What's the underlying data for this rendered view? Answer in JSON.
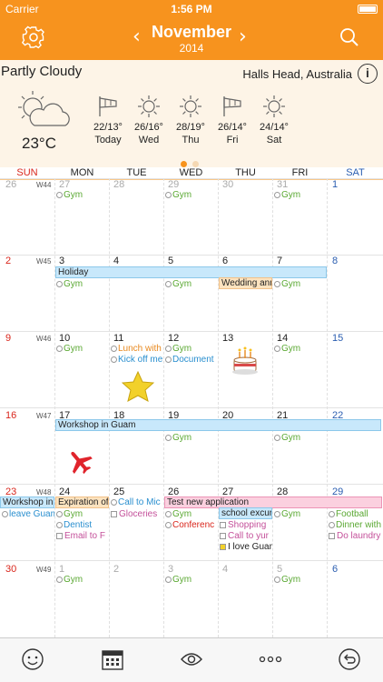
{
  "status": {
    "carrier": "Carrier",
    "time": "1:56 PM"
  },
  "nav": {
    "month": "November",
    "year": "2014"
  },
  "weather": {
    "condition": "Partly Cloudy",
    "location": "Halls Head, Australia",
    "info": "i",
    "temp": "23°C",
    "forecast": [
      {
        "temp": "22/13°",
        "day": "Today",
        "icon": "wind-icon"
      },
      {
        "temp": "26/16°",
        "day": "Wed",
        "icon": "sun-icon"
      },
      {
        "temp": "28/19°",
        "day": "Thu",
        "icon": "sun-icon"
      },
      {
        "temp": "26/14°",
        "day": "Fri",
        "icon": "wind-icon"
      },
      {
        "temp": "24/14°",
        "day": "Sat",
        "icon": "sun-icon"
      }
    ]
  },
  "weekdays": [
    "SUN",
    "MON",
    "TUE",
    "WED",
    "THU",
    "FRI",
    "SAT"
  ],
  "colors": {
    "accent": "#f7931e",
    "sunday": "#d9261c",
    "saturday": "#2a5db0",
    "green": "#5aa832",
    "holiday": "#c8e8fb",
    "wedding": "#fce3bf",
    "pink": "#fbd0df"
  },
  "weeks": [
    {
      "label": "W44",
      "days": [
        "26",
        "27",
        "28",
        "29",
        "30",
        "31",
        "1"
      ]
    },
    {
      "label": "W45",
      "days": [
        "2",
        "3",
        "4",
        "5",
        "6",
        "7",
        "8"
      ]
    },
    {
      "label": "W46",
      "days": [
        "9",
        "10",
        "11",
        "12",
        "13",
        "14",
        "15"
      ]
    },
    {
      "label": "W47",
      "days": [
        "16",
        "17",
        "18",
        "19",
        "20",
        "21",
        "22"
      ]
    },
    {
      "label": "W48",
      "days": [
        "23",
        "24",
        "25",
        "26",
        "27",
        "28",
        "29"
      ]
    },
    {
      "label": "W49",
      "days": [
        "30",
        "1",
        "2",
        "3",
        "4",
        "5",
        "6"
      ]
    }
  ],
  "events": {
    "gym": "Gym",
    "holiday": "Holiday",
    "wedding": "Wedding anniversary",
    "lunch": "Lunch with",
    "kickoff": "Kick off me",
    "document": "Document",
    "workshop": "Workshop in Guam",
    "workshop_short": "Workshop in",
    "leave": "leave Guam",
    "expiration": "Expiration of",
    "dentist": "Dentist",
    "email": "Email to F",
    "callmic": "Call to Mic",
    "glaceries": "Gloceries",
    "testapp": "Test new application",
    "conference": "Conferenc",
    "school": "school excursion",
    "shopping": "Shopping",
    "callto": "Call to yur",
    "iloveguam": "I love Guam",
    "football": "Football",
    "dinner": "Dinner with",
    "laundry": "Do laundry"
  }
}
